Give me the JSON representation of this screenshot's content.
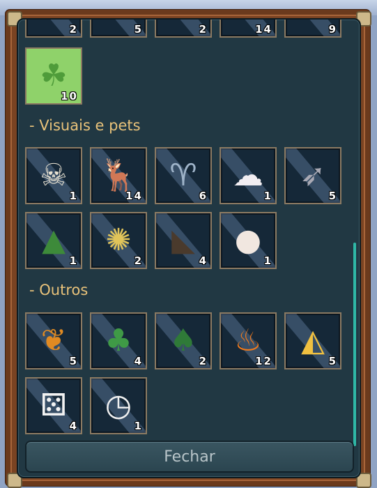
{
  "top_row_counts": [
    "2",
    "5",
    "2",
    "14",
    "9"
  ],
  "clover_item": {
    "icon": "clover-card-icon",
    "count": "10"
  },
  "sections": [
    {
      "title": "- Visuais e pets",
      "items": [
        {
          "icon": "skeleton-dog-icon",
          "count": "1"
        },
        {
          "icon": "reindeer-icon",
          "count": "14"
        },
        {
          "icon": "angel-mouse-icon",
          "count": "6"
        },
        {
          "icon": "ghost-mouse-icon",
          "count": "1"
        },
        {
          "icon": "bow-mouse-icon",
          "count": "5"
        },
        {
          "icon": "christmas-tree-mouse-icon",
          "count": "1"
        },
        {
          "icon": "golden-mask-mouse-icon",
          "count": "2"
        },
        {
          "icon": "bat-icon",
          "count": "4"
        },
        {
          "icon": "white-mouse-icon",
          "count": "1"
        }
      ]
    },
    {
      "title": "- Outros",
      "items": [
        {
          "icon": "autumn-leaves-icon",
          "count": "5"
        },
        {
          "icon": "potted-plant-icon",
          "count": "4"
        },
        {
          "icon": "mistletoe-icon",
          "count": "2"
        },
        {
          "icon": "campfire-icon",
          "count": "12"
        },
        {
          "icon": "cheese-icon",
          "count": "5"
        },
        {
          "icon": "dice-icon",
          "count": "4"
        },
        {
          "icon": "clock-icon",
          "count": "1"
        }
      ]
    }
  ],
  "close_button": "Fechar"
}
